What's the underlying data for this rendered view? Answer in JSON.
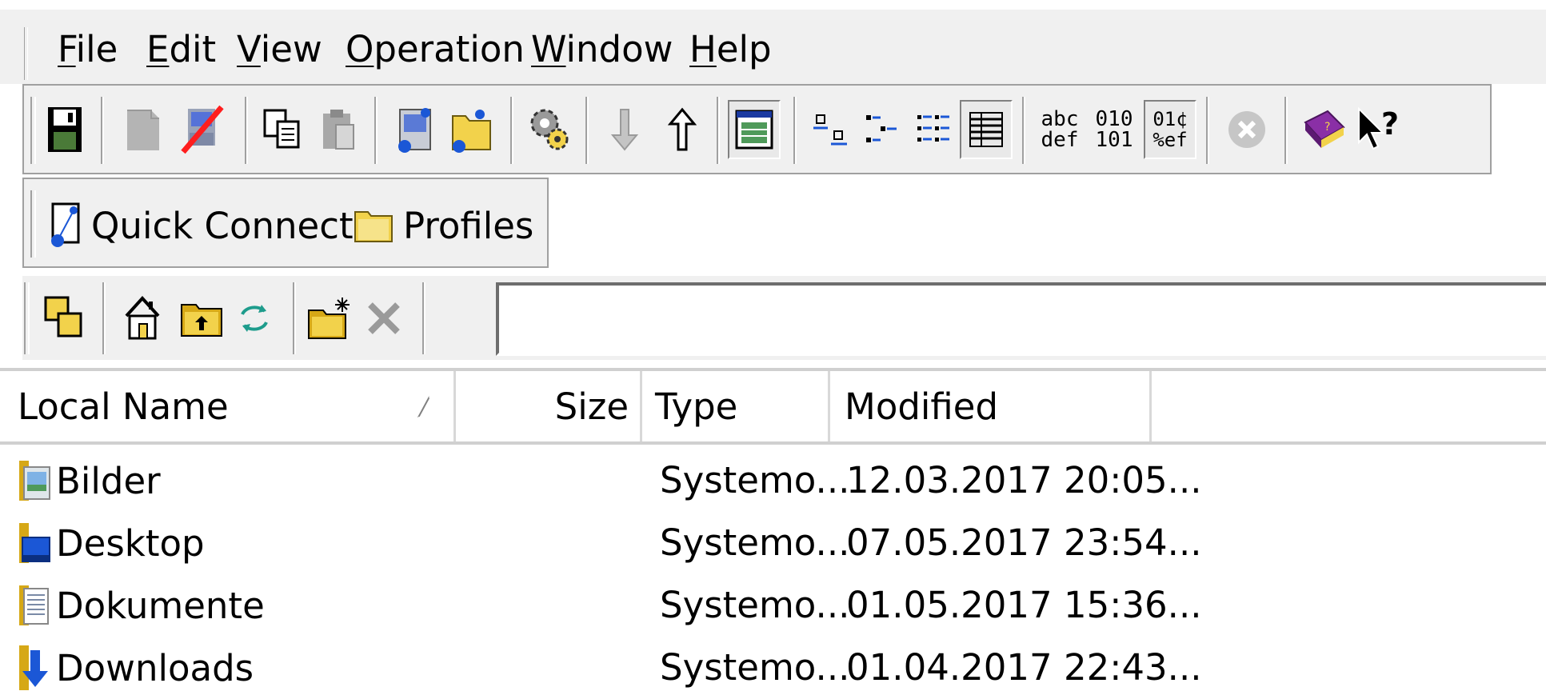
{
  "menu": {
    "items": [
      {
        "label": "File",
        "accel": "F",
        "rest": "ile"
      },
      {
        "label": "Edit",
        "accel": "E",
        "rest": "dit"
      },
      {
        "label": "View",
        "accel": "V",
        "rest": "iew"
      },
      {
        "label": "Operation",
        "accel": "O",
        "rest": "peration"
      },
      {
        "label": "Window",
        "accel": "W",
        "rest": "indow"
      },
      {
        "label": "Help",
        "accel": "H",
        "rest": "elp"
      }
    ]
  },
  "toolbar": {
    "icons": [
      "save-icon",
      "disconnect-icon",
      "no-disconnect-icon",
      "copy-icon",
      "paste-icon",
      "new-connection-icon",
      "new-profile-icon",
      "settings-icon",
      "download-icon",
      "upload-icon",
      "explorer-view-icon",
      "large-icons-view-icon",
      "small-icons-view-icon",
      "list-view-icon",
      "details-view-icon",
      "ascii-mode-icon",
      "binary-mode-icon",
      "auto-mode-icon",
      "cancel-icon",
      "help-book-icon",
      "context-help-icon"
    ],
    "mode_labels": {
      "ascii_top": "abc",
      "ascii_bottom": "def",
      "binary_top": "010",
      "binary_bottom": "101",
      "auto_top": "01¢",
      "auto_bottom": "%ef"
    }
  },
  "connect": {
    "quick_connect": "Quick Connect",
    "profiles": "Profiles"
  },
  "nav": {
    "path_value": ""
  },
  "list": {
    "columns": {
      "name": "Local Name",
      "size": "Size",
      "type": "Type",
      "modified": "Modified"
    },
    "rows": [
      {
        "name": "Bilder",
        "size": "",
        "type": "Systemo...",
        "modified": "12.03.2017 20:05...",
        "icon": "pictures-folder-icon"
      },
      {
        "name": "Desktop",
        "size": "",
        "type": "Systemo...",
        "modified": "07.05.2017 23:54...",
        "icon": "desktop-folder-icon"
      },
      {
        "name": "Dokumente",
        "size": "",
        "type": "Systemo...",
        "modified": "01.05.2017 15:36...",
        "icon": "documents-folder-icon"
      },
      {
        "name": "Downloads",
        "size": "",
        "type": "Systemo...",
        "modified": "01.04.2017 22:43...",
        "icon": "downloads-folder-icon"
      }
    ]
  },
  "colors": {
    "chrome": "#f0f0f0",
    "folder": "#f2d24b",
    "accent_blue": "#1b57d6"
  }
}
